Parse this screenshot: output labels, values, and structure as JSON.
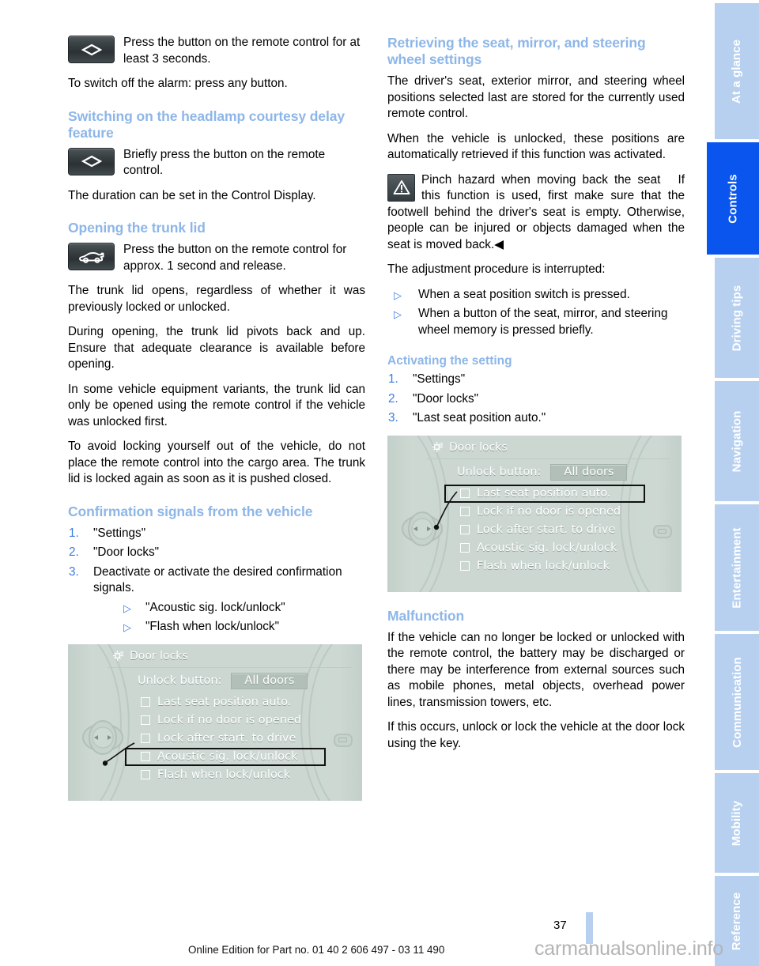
{
  "page": {
    "number": "37",
    "footer_note": "Online Edition for Part no. 01 40 2 606 497 - 03 11 490",
    "watermark": "carmanualsonline.info"
  },
  "colors": {
    "heading_blue": "#8db6e8",
    "list_marker_blue": "#3c7ce0",
    "tab_inactive": "#b7d0ef",
    "tab_active": "#0a55ee",
    "display_bg": "#ccd7d2"
  },
  "sidebar": {
    "tabs": [
      {
        "label": "At a glance",
        "active": false
      },
      {
        "label": "Controls",
        "active": true
      },
      {
        "label": "Driving tips",
        "active": false
      },
      {
        "label": "Navigation",
        "active": false
      },
      {
        "label": "Entertainment",
        "active": false
      },
      {
        "label": "Communication",
        "active": false
      },
      {
        "label": "Mobility",
        "active": false
      },
      {
        "label": "Reference",
        "active": false
      }
    ]
  },
  "left_column": {
    "alarm_icon_para": "Press the button on the remote control for at least 3 seconds.",
    "alarm_off_para": "To switch off the alarm: press any button.",
    "headlamp_heading": "Switching on the headlamp courtesy delay feature",
    "headlamp_icon_para": "Briefly press the button on the remote control.",
    "headlamp_duration_para": "The duration can be set in the Control Display.",
    "trunk_heading": "Opening the trunk lid",
    "trunk_icon_para": "Press the button on the remote control for approx. 1 second and release.",
    "trunk_p1": "The trunk lid opens, regardless of whether it was previously locked or unlocked.",
    "trunk_p2": "During opening, the trunk lid pivots back and up. Ensure that adequate clearance is available before opening.",
    "trunk_p3": "In some vehicle equipment variants, the trunk lid can only be opened using the remote control if the vehicle was unlocked first.",
    "trunk_p4": "To avoid locking yourself out of the vehicle, do not place the remote control into the cargo area. The trunk lid is locked again as soon as it is pushed closed.",
    "confirmation_heading": "Confirmation signals from the vehicle",
    "confirmation_steps": [
      {
        "num": "1.",
        "text": "\"Settings\""
      },
      {
        "num": "2.",
        "text": "\"Door locks\""
      },
      {
        "num": "3.",
        "text": "Deactivate or activate the desired confirmation signals."
      }
    ],
    "confirmation_subitems": [
      {
        "marker": "▷",
        "text": "\"Acoustic sig. lock/unlock\""
      },
      {
        "marker": "▷",
        "text": "\"Flash when lock/unlock\""
      }
    ],
    "display": {
      "title": "Door locks",
      "unlock_label": "Unlock button:",
      "unlock_value": "All doors",
      "options": [
        {
          "text": "Last seat position auto.",
          "highlighted": false
        },
        {
          "text": "Lock if no door is opened",
          "highlighted": false
        },
        {
          "text": "Lock after start. to drive",
          "highlighted": false
        },
        {
          "text": "Acoustic sig. lock/unlock",
          "highlighted": true
        },
        {
          "text": "Flash when lock/unlock",
          "highlighted": false
        }
      ]
    }
  },
  "right_column": {
    "retrieving_heading": "Retrieving the seat, mirror, and steering wheel settings",
    "retrieving_p1": "The driver's seat, exterior mirror, and steering wheel positions selected last are stored for the currently used remote control.",
    "retrieving_p2": "When the vehicle is unlocked, these positions are automatically retrieved if this function was activated.",
    "warning_title": "Pinch hazard when moving back the seat",
    "warning_body": "If this function is used, first make sure that the footwell behind the driver's seat is empty. Otherwise, people can be injured or objects damaged when the seat is moved back.◀",
    "interrupt_intro": "The adjustment procedure is interrupted:",
    "interrupt_items": [
      {
        "marker": "▷",
        "text": "When a seat position switch is pressed."
      },
      {
        "marker": "▷",
        "text": "When a button of the seat, mirror, and steering wheel memory is pressed briefly."
      }
    ],
    "activating_heading": "Activating the setting",
    "activating_steps": [
      {
        "num": "1.",
        "text": "\"Settings\""
      },
      {
        "num": "2.",
        "text": "\"Door locks\""
      },
      {
        "num": "3.",
        "text": "\"Last seat position auto.\""
      }
    ],
    "display": {
      "title": "Door locks",
      "unlock_label": "Unlock button:",
      "unlock_value": "All doors",
      "options": [
        {
          "text": "Last seat position auto.",
          "highlighted": true
        },
        {
          "text": "Lock if no door is opened",
          "highlighted": false
        },
        {
          "text": "Lock after start. to drive",
          "highlighted": false
        },
        {
          "text": "Acoustic sig. lock/unlock",
          "highlighted": false
        },
        {
          "text": "Flash when lock/unlock",
          "highlighted": false
        }
      ]
    },
    "malfunction_heading": "Malfunction",
    "malfunction_p1": "If the vehicle can no longer be locked or unlocked with the remote control, the battery may be discharged or there may be interference from external sources such as mobile phones, metal objects, overhead power lines, transmission towers, etc.",
    "malfunction_p2": "If this occurs, unlock or lock the vehicle at the door lock using the key."
  }
}
